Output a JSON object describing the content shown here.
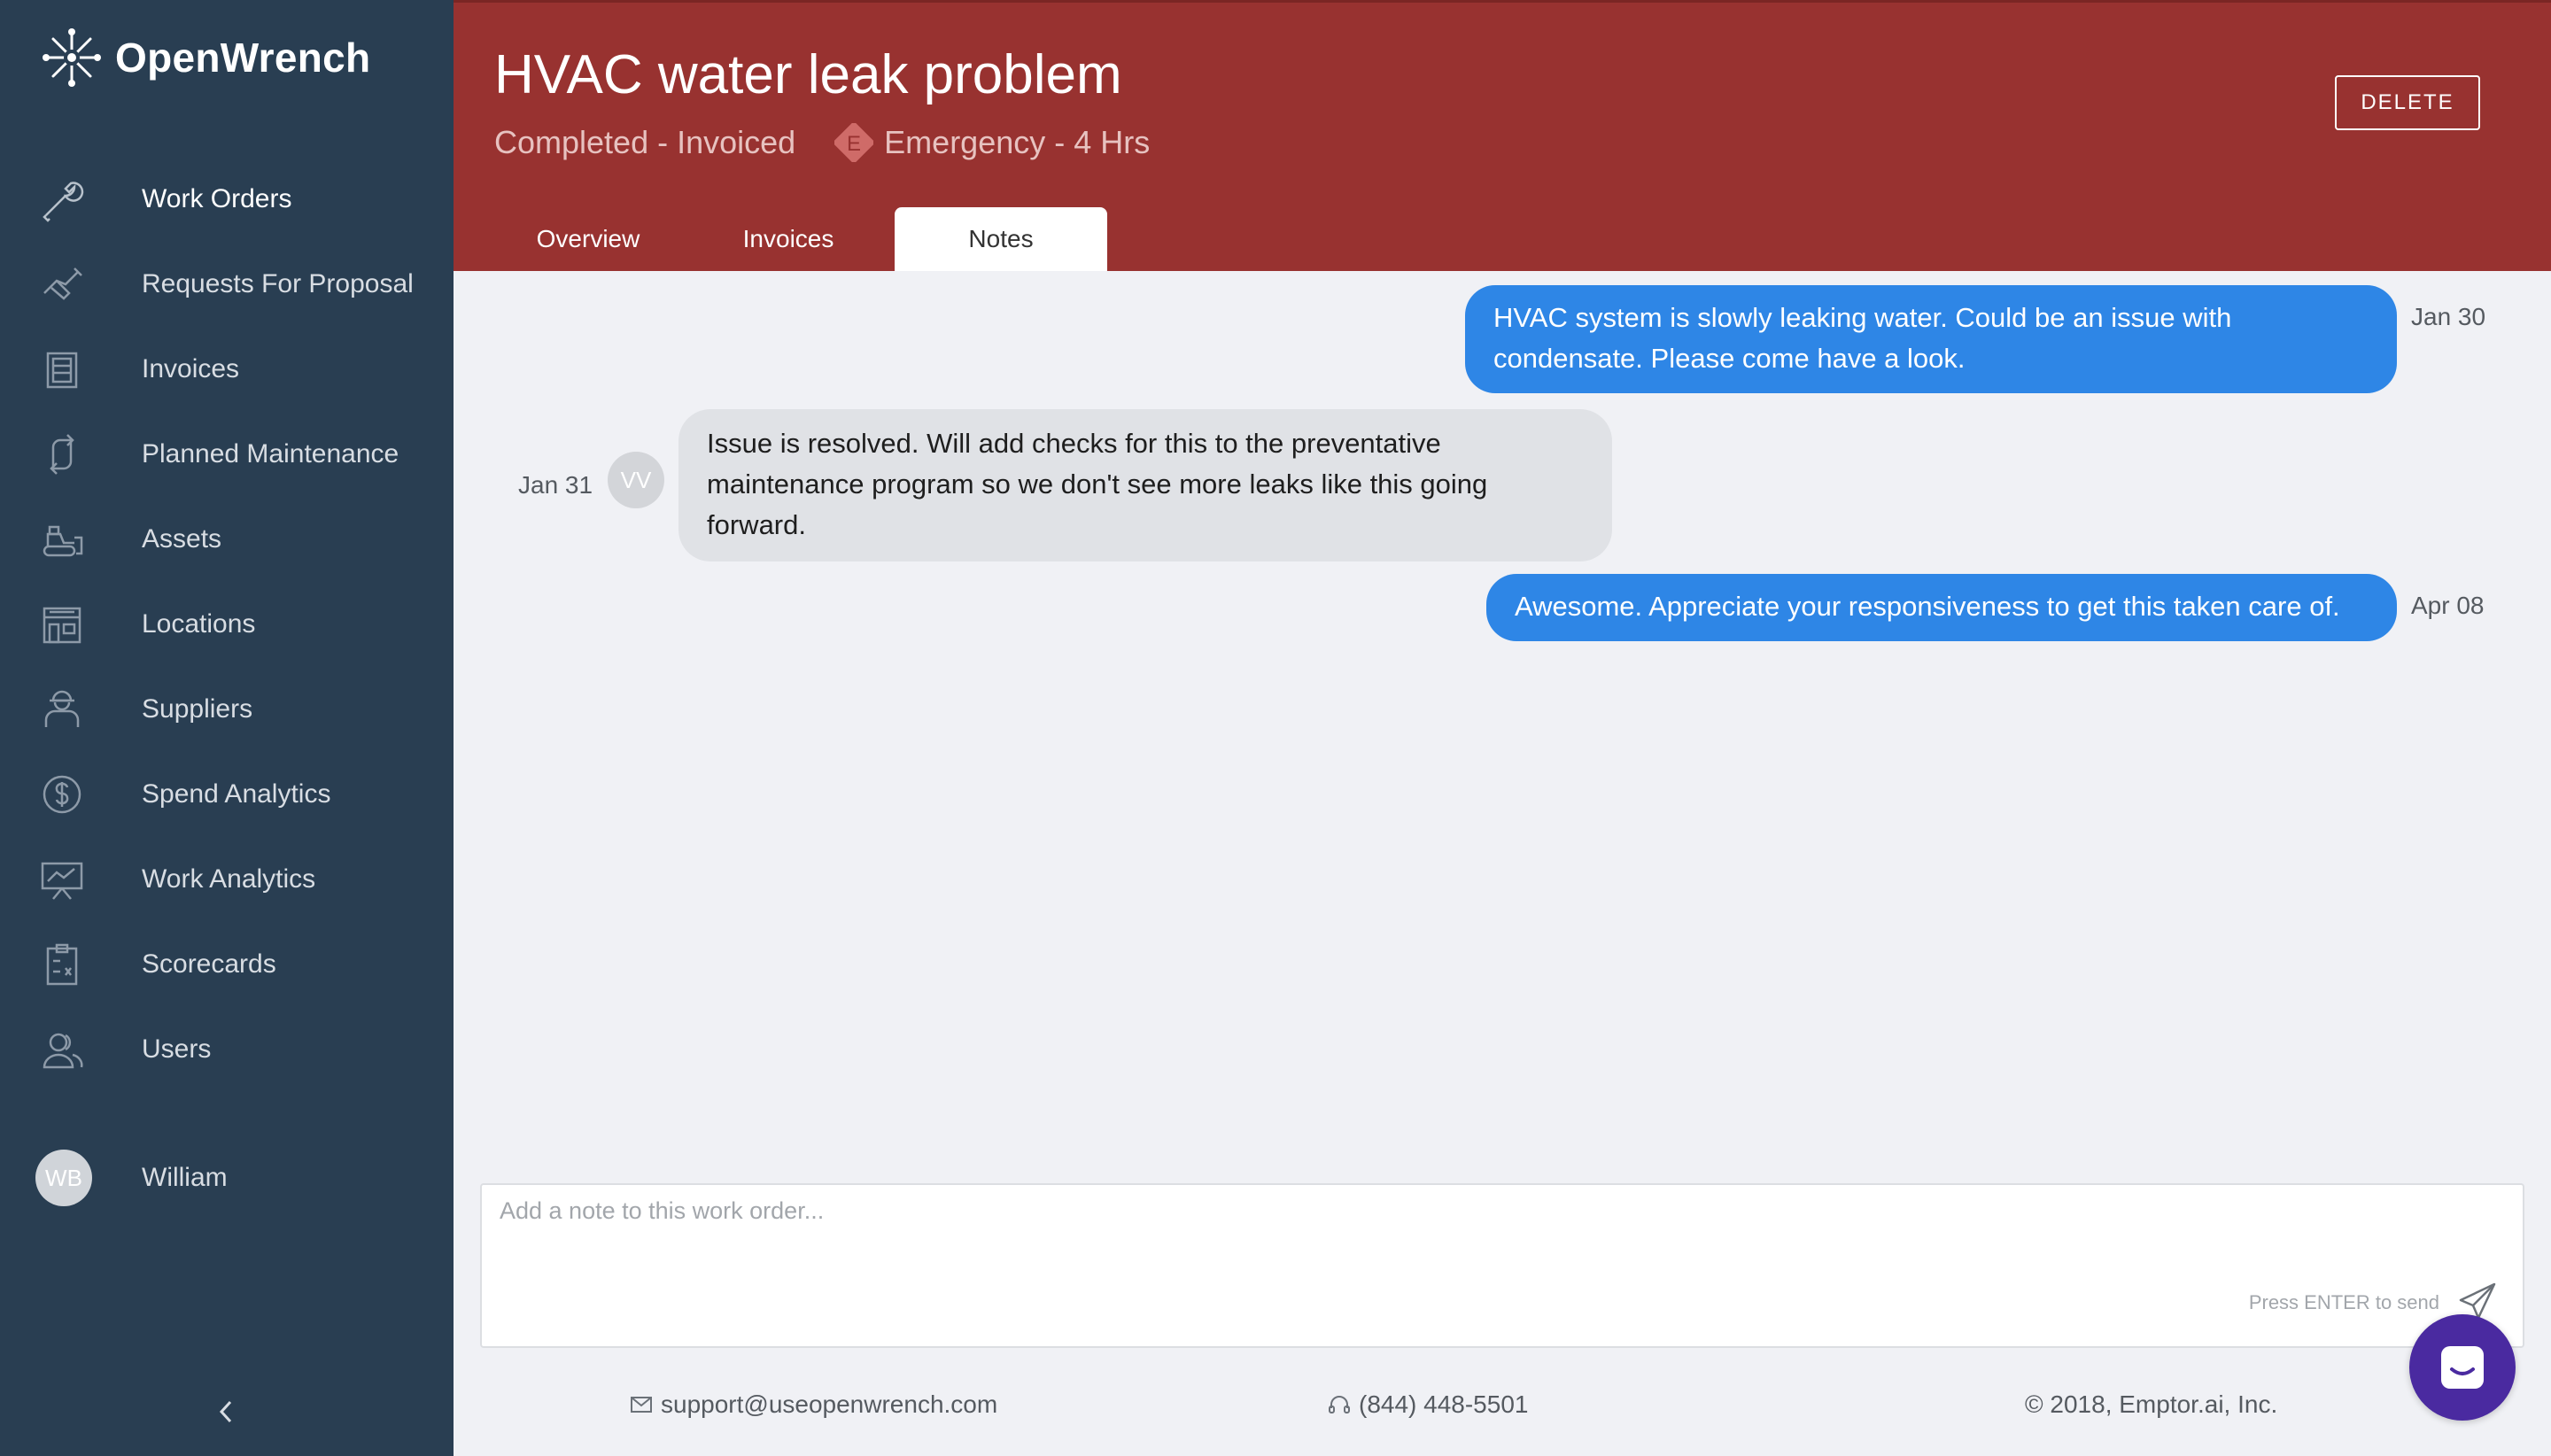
{
  "app": {
    "name": "OpenWrench"
  },
  "sidebar": {
    "items": [
      {
        "label": "Work Orders",
        "icon": "wrench-icon",
        "active": true
      },
      {
        "label": "Requests For Proposal",
        "icon": "handshake-icon"
      },
      {
        "label": "Invoices",
        "icon": "invoice-icon"
      },
      {
        "label": "Planned Maintenance",
        "icon": "cycle-arrows-icon"
      },
      {
        "label": "Assets",
        "icon": "bulldozer-icon"
      },
      {
        "label": "Locations",
        "icon": "building-icon"
      },
      {
        "label": "Suppliers",
        "icon": "worker-icon"
      },
      {
        "label": "Spend Analytics",
        "icon": "dollar-circle-icon"
      },
      {
        "label": "Work Analytics",
        "icon": "presentation-chart-icon"
      },
      {
        "label": "Scorecards",
        "icon": "clipboard-icon"
      },
      {
        "label": "Users",
        "icon": "users-icon"
      }
    ],
    "user": {
      "initials": "WB",
      "name": "William"
    },
    "collapse_icon": "chevron-left-icon"
  },
  "header": {
    "title": "HVAC water leak problem",
    "status": "Completed - Invoiced",
    "priority_badge": "E",
    "priority_label": "Emergency - 4 Hrs",
    "delete_label": "DELETE",
    "tabs": [
      "Overview",
      "Invoices",
      "Notes"
    ],
    "active_tab": "Notes",
    "color": "#983230"
  },
  "notes": [
    {
      "direction": "out",
      "text": "HVAC system is slowly leaking water. Could be an issue with condensate. Please come have a look.",
      "date": "Jan 30"
    },
    {
      "direction": "in",
      "text": "Issue is resolved. Will add checks for this to the preventative maintenance program so we don't see more leaks like this going forward.",
      "date": "Jan 31",
      "initials": "VV"
    },
    {
      "direction": "out",
      "text": "Awesome. Appreciate your responsiveness to get this taken care of.",
      "date": "Apr 08"
    }
  ],
  "composer": {
    "placeholder": "Add a note to this work order...",
    "hint": "Press ENTER to send"
  },
  "footer": {
    "email": "support@useopenwrench.com",
    "phone": "(844) 448-5501",
    "copyright": "© 2018, Emptor.ai, Inc."
  },
  "colors": {
    "sidebar": "#293e52",
    "bubble_out": "#2e86e6",
    "bubble_in": "#e0e2e6",
    "launcher": "#4a2aa0"
  }
}
